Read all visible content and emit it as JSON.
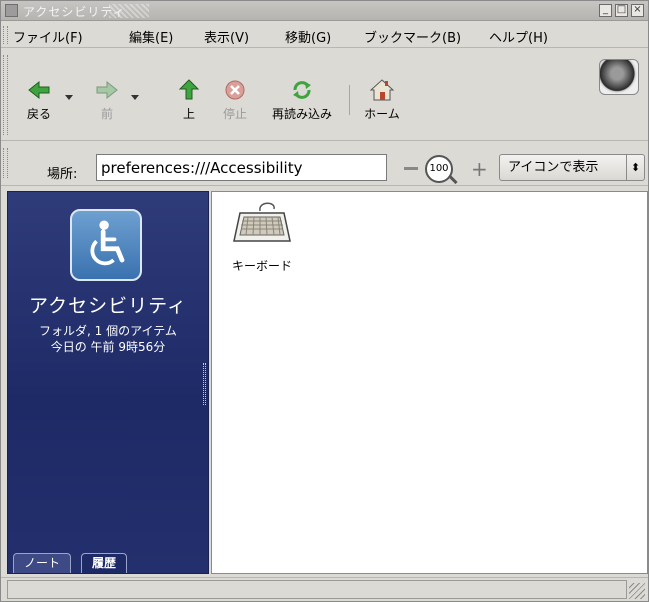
{
  "window": {
    "title": "アクセシビリティ"
  },
  "menubar": {
    "items": [
      {
        "label": "ファイル(F)"
      },
      {
        "label": "編集(E)"
      },
      {
        "label": "表示(V)"
      },
      {
        "label": "移動(G)"
      },
      {
        "label": "ブックマーク(B)"
      },
      {
        "label": "ヘルプ(H)"
      }
    ]
  },
  "toolbar": {
    "back": {
      "label": "戻る",
      "icon": "arrow-left-icon"
    },
    "forward": {
      "label": "前",
      "icon": "arrow-right-icon"
    },
    "up": {
      "label": "上",
      "icon": "arrow-up-icon"
    },
    "stop": {
      "label": "停止",
      "icon": "stop-icon"
    },
    "reload": {
      "label": "再読み込み",
      "icon": "reload-icon"
    },
    "home": {
      "label": "ホーム",
      "icon": "home-icon"
    }
  },
  "location": {
    "label": "場所:",
    "value": "preferences:///Accessibility",
    "zoom_level": "100",
    "view_mode": "アイコンで表示"
  },
  "sidebar": {
    "title": "アクセシビリティ",
    "meta_line1": "フォルダ, 1 個のアイテム",
    "meta_line2": "今日の 午前 9時56分",
    "tabs": [
      {
        "label": "ノート"
      },
      {
        "label": "履歴"
      }
    ]
  },
  "content": {
    "items": [
      {
        "label": "キーボード",
        "icon": "keyboard-icon"
      }
    ]
  },
  "statusbar": {
    "text": ""
  },
  "colors": {
    "sidebar_bg": "#1e2a66",
    "window_bg": "#dcdad5",
    "accent_blue": "#3a72b0"
  }
}
